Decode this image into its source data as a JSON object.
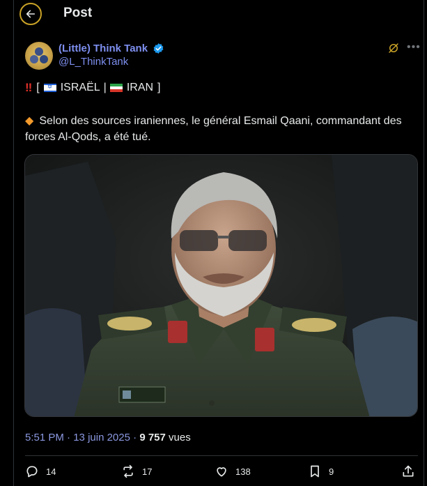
{
  "header": {
    "title": "Post",
    "back_icon": "arrow-left-icon"
  },
  "author": {
    "display_name": "(Little) Think Tank",
    "handle": "@L_ThinkTank",
    "verified_color": "#1d9bf0",
    "name_color": "#7e8ff0"
  },
  "tweet": {
    "headline_open": "[",
    "country_a": "ISRAËL",
    "separator": "|",
    "country_b": "IRAN",
    "headline_close": "]",
    "body": "Selon des sources iraniennes, le général Esmail Qaani, commandant des forces Al-Qods, a été tué."
  },
  "meta": {
    "time": "5:51 PM",
    "dot": "·",
    "date": "13 juin 2025",
    "views": "9 757",
    "views_label": "vues"
  },
  "actions": {
    "replies": "14",
    "reposts": "17",
    "likes": "138",
    "bookmarks": "9"
  },
  "colors": {
    "background": "#000000",
    "text": "#e7e9ea",
    "link": "#7e8ff0",
    "divider": "#2f3336"
  }
}
